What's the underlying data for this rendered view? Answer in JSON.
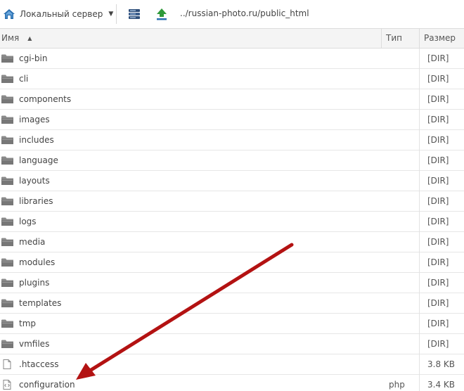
{
  "toolbar": {
    "server_label": "Локальный сервер",
    "path": "../russian-photo.ru/public_html",
    "icons": [
      "home-icon",
      "chevron-down-icon",
      "server-icon",
      "upload-icon"
    ]
  },
  "table": {
    "columns": {
      "name": "Имя",
      "type": "Тип",
      "size": "Размер"
    },
    "sort": "ascending",
    "rows": [
      {
        "name": "cgi-bin",
        "type": "",
        "size": "[DIR]",
        "kind": "folder"
      },
      {
        "name": "cli",
        "type": "",
        "size": "[DIR]",
        "kind": "folder"
      },
      {
        "name": "components",
        "type": "",
        "size": "[DIR]",
        "kind": "folder"
      },
      {
        "name": "images",
        "type": "",
        "size": "[DIR]",
        "kind": "folder"
      },
      {
        "name": "includes",
        "type": "",
        "size": "[DIR]",
        "kind": "folder"
      },
      {
        "name": "language",
        "type": "",
        "size": "[DIR]",
        "kind": "folder"
      },
      {
        "name": "layouts",
        "type": "",
        "size": "[DIR]",
        "kind": "folder"
      },
      {
        "name": "libraries",
        "type": "",
        "size": "[DIR]",
        "kind": "folder"
      },
      {
        "name": "logs",
        "type": "",
        "size": "[DIR]",
        "kind": "folder"
      },
      {
        "name": "media",
        "type": "",
        "size": "[DIR]",
        "kind": "folder"
      },
      {
        "name": "modules",
        "type": "",
        "size": "[DIR]",
        "kind": "folder"
      },
      {
        "name": "plugins",
        "type": "",
        "size": "[DIR]",
        "kind": "folder"
      },
      {
        "name": "templates",
        "type": "",
        "size": "[DIR]",
        "kind": "folder"
      },
      {
        "name": "tmp",
        "type": "",
        "size": "[DIR]",
        "kind": "folder"
      },
      {
        "name": "vmfiles",
        "type": "",
        "size": "[DIR]",
        "kind": "folder"
      },
      {
        "name": ".htaccess",
        "type": "",
        "size": "3.8 KB",
        "kind": "file"
      },
      {
        "name": "configuration",
        "type": "php",
        "size": "3.4 KB",
        "kind": "code-file"
      }
    ]
  },
  "colors": {
    "folder": "#8a8a8a",
    "accent": "#2a6fb0",
    "arrow": "#b31212",
    "header_bg": "#f4f4f4"
  }
}
